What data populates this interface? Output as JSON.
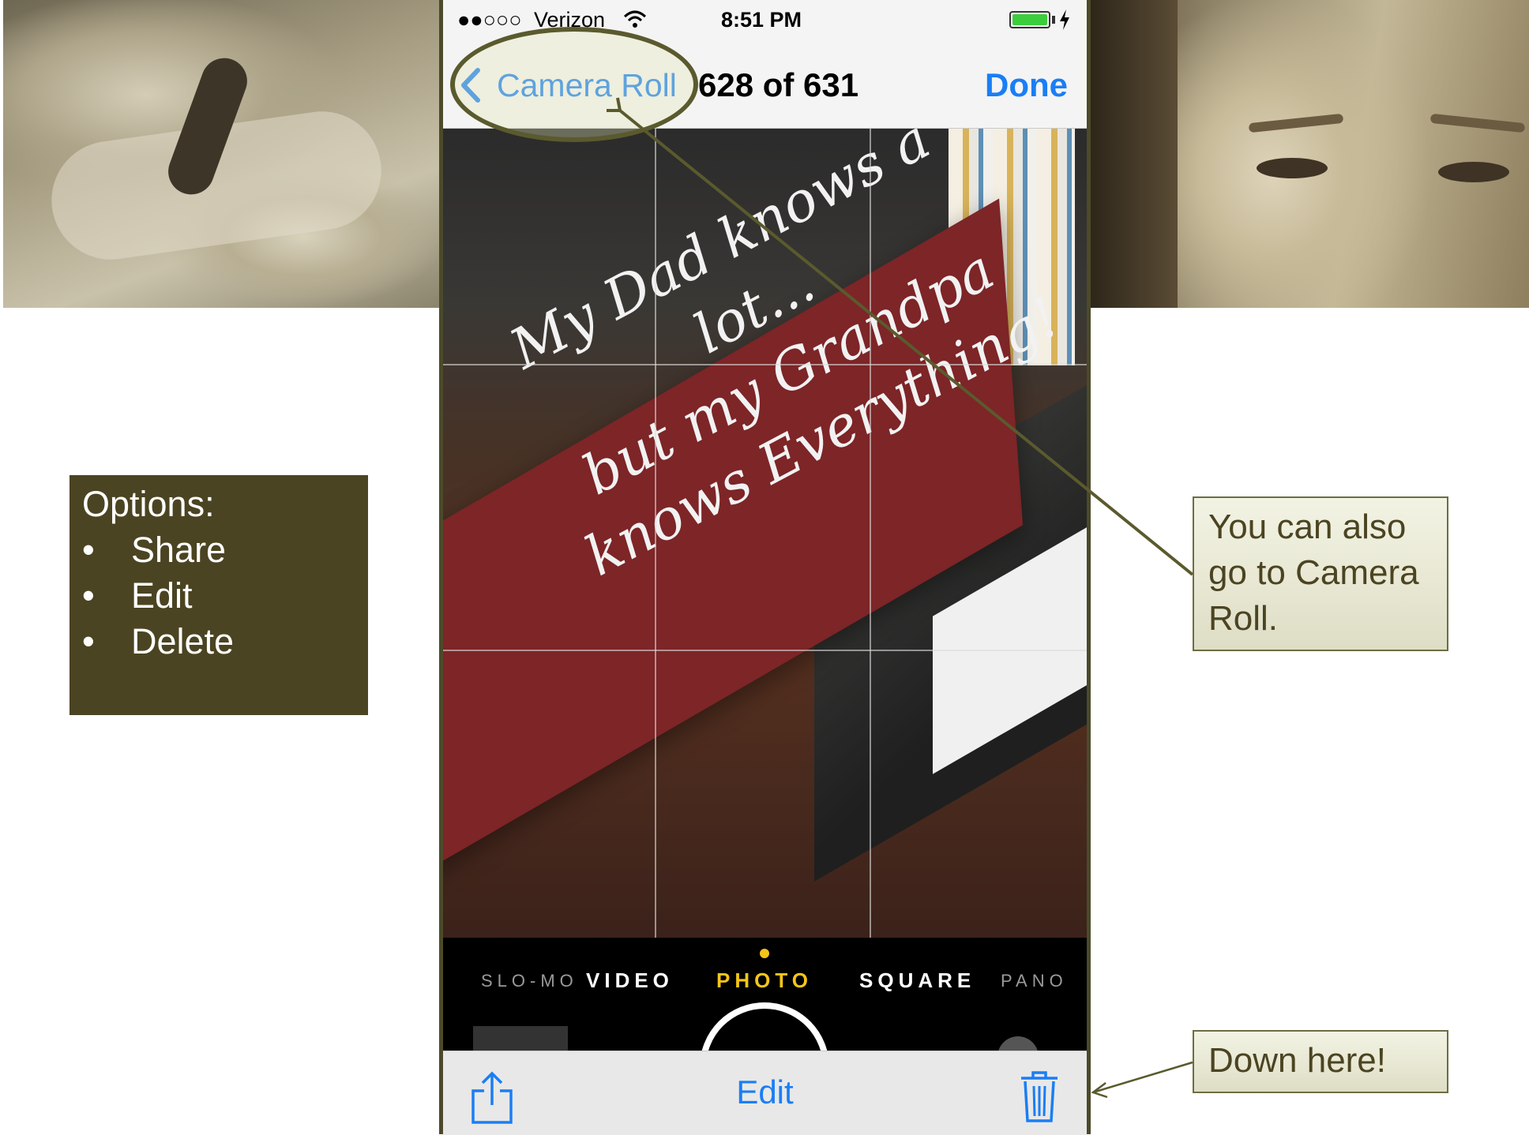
{
  "status_bar": {
    "signal": "●●○○○",
    "carrier": "Verizon",
    "time": "8:51 PM"
  },
  "nav_bar": {
    "back_label": "Camera Roll",
    "photo_count": "628 of 631",
    "done_label": "Done"
  },
  "photo": {
    "sign_lines": [
      "My Dad knows a lot...",
      "but my Grandpa",
      "knows Everything!"
    ]
  },
  "camera_modes": {
    "items": [
      "SLO-MO",
      "VIDEO",
      "PHOTO",
      "SQUARE",
      "PANO"
    ],
    "active": "PHOTO"
  },
  "toolbar": {
    "share_icon": "share-icon",
    "edit_label": "Edit",
    "trash_icon": "trash-icon"
  },
  "annotations": {
    "options": {
      "title": "Options:",
      "items": [
        "Share",
        "Edit",
        "Delete"
      ]
    },
    "camera_roll_note": "You can also go to Camera Roll.",
    "down_here_note": "Down here!"
  },
  "colors": {
    "ios_blue": "#1a7ef5",
    "annotation_olive": "#4b4422",
    "active_mode": "#f5c518"
  }
}
